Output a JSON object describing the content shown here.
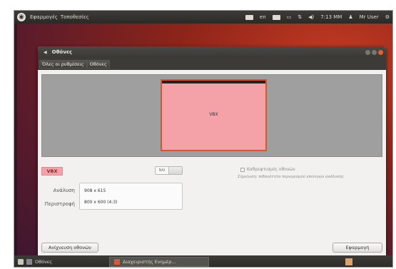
{
  "top_panel": {
    "menu": [
      "Εφαρμογές",
      "Τοποθεσίες"
    ],
    "keyboard_layout": "en",
    "clock": "7:13 MM",
    "user": "Mr User"
  },
  "window": {
    "title": "Οθόνες",
    "breadcrumbs": [
      "Όλες οι ρυθμίσεις",
      "Οθόνες"
    ]
  },
  "display": {
    "monitor_label": "VBX",
    "selected_name": "VBX",
    "toggle_label": "ΝΑΙ",
    "mirror_label": "Καθρεφτισμός οθονών",
    "note": "Σημείωση: πιθανότητα περιορισμού επιλογών ανάλυσης",
    "resolution_label": "Ανάλυση",
    "resolution_value": "908 x 615",
    "rotation_label": "Περιστροφή",
    "rotation_value": "800 x 600 (4:3)"
  },
  "buttons": {
    "detect": "Ανίχνευση οθονών",
    "apply": "Εφαρμογή"
  },
  "bottom_panel": {
    "task1": "Οθόνες",
    "task2": "Διαχειριστής Ενημέρ..."
  },
  "colors": {
    "desktop": "#8e2419",
    "panel": "#3c3b37",
    "monitor_fill": "#f4a1a8",
    "monitor_border": "#e0522c",
    "close_button": "#e3602f"
  }
}
